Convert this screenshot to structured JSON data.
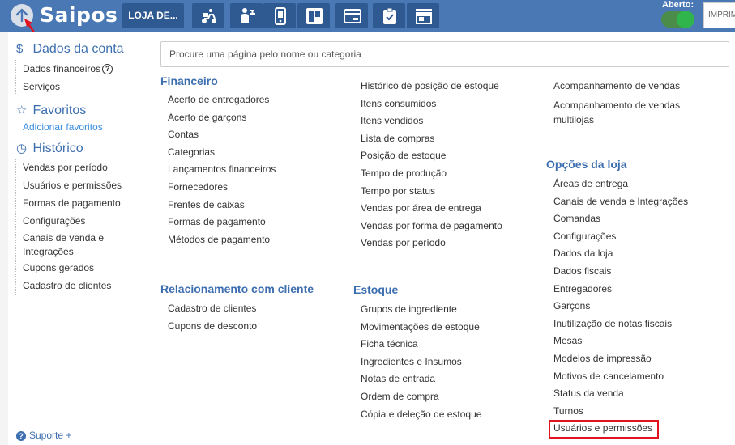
{
  "brand": {
    "name": "Saipos"
  },
  "header": {
    "store_label": "LOJA DE...",
    "toolbar_icons": [
      "delivery-scooter-icon",
      "waiter-icon",
      "phone-order-icon",
      "kanban-board-icon",
      "card-reader-icon",
      "clipboard-check-icon",
      "storefront-icon"
    ],
    "status_label": "Aberto:",
    "print_label": "IMPRIM",
    "colors": {
      "bar": "#4a78b5",
      "button": "#2f5a91",
      "toggle": "#2fb54b",
      "highlight": "#e0141e"
    }
  },
  "sidebar": {
    "account": {
      "icon": "dollar-icon",
      "title": "Dados da conta",
      "items": [
        "Dados financeiros",
        "Serviços"
      ]
    },
    "favorites": {
      "icon": "star-icon",
      "title": "Favoritos",
      "add_link": "Adicionar favoritos"
    },
    "history": {
      "icon": "clock-icon",
      "title": "Histórico",
      "items": [
        "Vendas por período",
        "Usuários e permissões",
        "Formas de pagamento",
        "Configurações",
        "Canais de venda e Integrações",
        "Cupons gerados",
        "Cadastro de clientes"
      ]
    },
    "support": {
      "label": "Suporte",
      "plus": "+"
    }
  },
  "search": {
    "placeholder": "Procure uma página pelo nome ou categoria"
  },
  "categories": {
    "financeiro": {
      "title": "Financeiro",
      "items": [
        "Acerto de entregadores",
        "Acerto de garçons",
        "Contas",
        "Categorias",
        "Lançamentos financeiros",
        "Fornecedores",
        "Frentes de caixas",
        "Formas de pagamento",
        "Métodos de pagamento"
      ]
    },
    "relatorios": {
      "items": [
        "Histórico de posição de estoque",
        "Itens consumidos",
        "Itens vendidos",
        "Lista de compras",
        "Posição de estoque",
        "Tempo de produção",
        "Tempo por status",
        "Vendas por área de entrega",
        "Vendas por forma de pagamento",
        "Vendas por período"
      ]
    },
    "relatorios_right": {
      "items": [
        "Acompanhamento de vendas",
        "Acompanhamento de vendas multilojas"
      ]
    },
    "relacionamento": {
      "title": "Relacionamento com cliente",
      "items": [
        "Cadastro de clientes",
        "Cupons de desconto"
      ]
    },
    "estoque": {
      "title": "Estoque",
      "items": [
        "Grupos de ingrediente",
        "Movimentações de estoque",
        "Ficha técnica",
        "Ingredientes e Insumos",
        "Notas de entrada",
        "Ordem de compra",
        "Cópia e deleção de estoque"
      ]
    },
    "opcoes": {
      "title": "Opções da loja",
      "items": [
        "Áreas de entrega",
        "Canais de venda e Integrações",
        "Comandas",
        "Configurações",
        "Dados da loja",
        "Dados fiscais",
        "Entregadores",
        "Garçons",
        "Inutilização de notas fiscais",
        "Mesas",
        "Modelos de impressão",
        "Motivos de cancelamento",
        "Status da venda",
        "Turnos",
        "Usuários e permissões"
      ]
    }
  }
}
